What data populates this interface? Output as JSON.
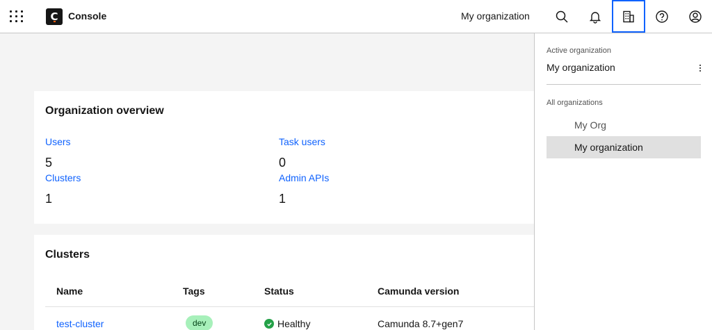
{
  "header": {
    "app_name": "Console",
    "org_name": "My organization",
    "icons": [
      "app-switcher-icon",
      "search-icon",
      "notification-icon",
      "organization-icon",
      "help-icon",
      "user-icon"
    ]
  },
  "overview": {
    "title": "Organization overview",
    "stats": [
      {
        "label": "Users",
        "value": "5"
      },
      {
        "label": "Task users",
        "value": "0"
      },
      {
        "label": "Clusters",
        "value": "1"
      },
      {
        "label": "Admin APIs",
        "value": "1"
      }
    ]
  },
  "clusters": {
    "title": "Clusters",
    "columns": [
      "Name",
      "Tags",
      "Status",
      "Camunda version"
    ],
    "rows": [
      {
        "name": "test-cluster",
        "tag": "dev",
        "status": "Healthy",
        "version": "Camunda 8.7+gen7"
      }
    ]
  },
  "org_panel": {
    "active_label": "Active organization",
    "active_name": "My organization",
    "all_label": "All organizations",
    "items": [
      {
        "label": "My Org",
        "selected": false
      },
      {
        "label": "My organization",
        "selected": true
      }
    ]
  },
  "colors": {
    "accent": "#0f62fe",
    "healthy": "#24a148",
    "tag_bg": "#a7f0ba",
    "selected_bg": "#e0e0e0"
  }
}
